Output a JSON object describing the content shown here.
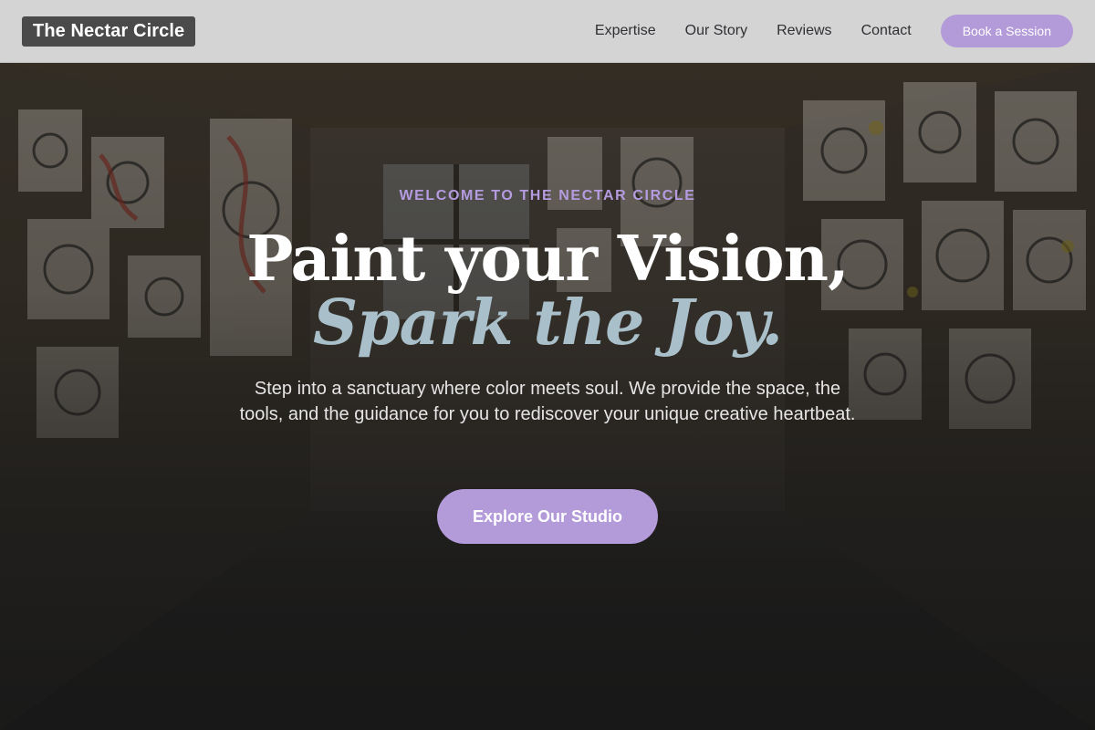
{
  "header": {
    "brand": "The Nectar Circle",
    "nav": [
      {
        "label": "Expertise"
      },
      {
        "label": "Our Story"
      },
      {
        "label": "Reviews"
      },
      {
        "label": "Contact"
      }
    ],
    "cta_label": "Book a Session"
  },
  "hero": {
    "eyebrow": "WELCOME TO THE NECTAR CIRCLE",
    "headline_line1": "Paint your Vision,",
    "headline_line2": "Spark the Joy.",
    "subtext": "Step into a sanctuary where color meets soul. We provide the space, the tools, and the guidance for you to rediscover your unique creative heartbeat.",
    "cta_label": "Explore Our Studio",
    "background_image": "art-studio-room-with-painted-walls"
  },
  "colors": {
    "accent": "#b39ad9",
    "eyebrow": "#b59be0",
    "headline_italic": "#a9bfca",
    "header_bg": "#e2e2e2",
    "brand_bg": "#4a4a4a"
  }
}
